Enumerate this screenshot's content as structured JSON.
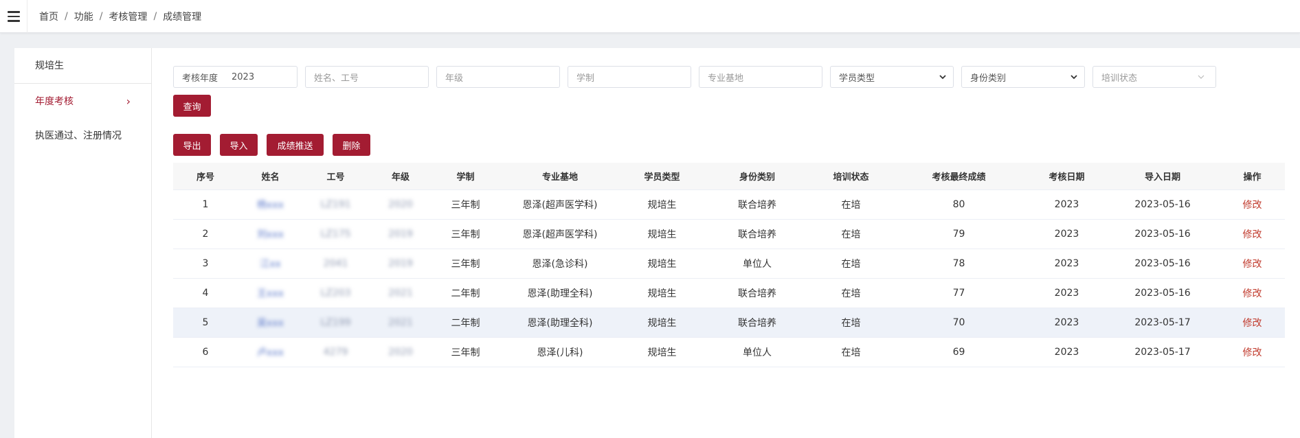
{
  "breadcrumb": [
    "首页",
    "功能",
    "考核管理",
    "成绩管理"
  ],
  "sidebar": {
    "header": "规培生",
    "items": [
      {
        "label": "年度考核",
        "active": true
      },
      {
        "label": "执医通过、注册情况",
        "active": false
      }
    ]
  },
  "filters": {
    "year_label": "考核年度",
    "year_value": "2023",
    "name_placeholder": "姓名、工号",
    "grade_placeholder": "年级",
    "duration_placeholder": "学制",
    "base_placeholder": "专业基地",
    "student_type": "学员类型",
    "identity_type": "身份类别",
    "training_status": "培训状态"
  },
  "buttons": {
    "query": "查询",
    "export": "导出",
    "import": "导入",
    "push": "成绩推送",
    "delete": "删除"
  },
  "table": {
    "columns": [
      "序号",
      "姓名",
      "工号",
      "年级",
      "学制",
      "专业基地",
      "学员类型",
      "身份类别",
      "培训状态",
      "考核最终成绩",
      "考核日期",
      "导入日期",
      "操作"
    ],
    "rows": [
      {
        "no": "1",
        "name": "杨xxx",
        "id": "LZ191",
        "grade": "2020",
        "duration": "三年制",
        "base": "恩泽(超声医学科)",
        "type": "规培生",
        "identity": "联合培养",
        "status": "在培",
        "score": "80",
        "exam_date": "2023",
        "import_date": "2023-05-16",
        "op": "修改"
      },
      {
        "no": "2",
        "name": "刘xxx",
        "id": "LZ175",
        "grade": "2019",
        "duration": "三年制",
        "base": "恩泽(超声医学科)",
        "type": "规培生",
        "identity": "联合培养",
        "status": "在培",
        "score": "79",
        "exam_date": "2023",
        "import_date": "2023-05-16",
        "op": "修改"
      },
      {
        "no": "3",
        "name": "江xx",
        "id": "2041",
        "grade": "2019",
        "duration": "三年制",
        "base": "恩泽(急诊科)",
        "type": "规培生",
        "identity": "单位人",
        "status": "在培",
        "score": "78",
        "exam_date": "2023",
        "import_date": "2023-05-16",
        "op": "修改"
      },
      {
        "no": "4",
        "name": "王xxx",
        "id": "LZ203",
        "grade": "2021",
        "duration": "二年制",
        "base": "恩泽(助理全科)",
        "type": "规培生",
        "identity": "联合培养",
        "status": "在培",
        "score": "77",
        "exam_date": "2023",
        "import_date": "2023-05-16",
        "op": "修改"
      },
      {
        "no": "5",
        "name": "吴xxx",
        "id": "LZ199",
        "grade": "2021",
        "duration": "二年制",
        "base": "恩泽(助理全科)",
        "type": "规培生",
        "identity": "联合培养",
        "status": "在培",
        "score": "70",
        "exam_date": "2023",
        "import_date": "2023-05-17",
        "op": "修改"
      },
      {
        "no": "6",
        "name": "卢xxx",
        "id": "4279",
        "grade": "2020",
        "duration": "三年制",
        "base": "恩泽(儿科)",
        "type": "规培生",
        "identity": "单位人",
        "status": "在培",
        "score": "69",
        "exam_date": "2023",
        "import_date": "2023-05-17",
        "op": "修改"
      }
    ]
  },
  "colors": {
    "accent": "#a31c32",
    "link": "#c0392b",
    "row_highlight": "#eef2f9"
  }
}
